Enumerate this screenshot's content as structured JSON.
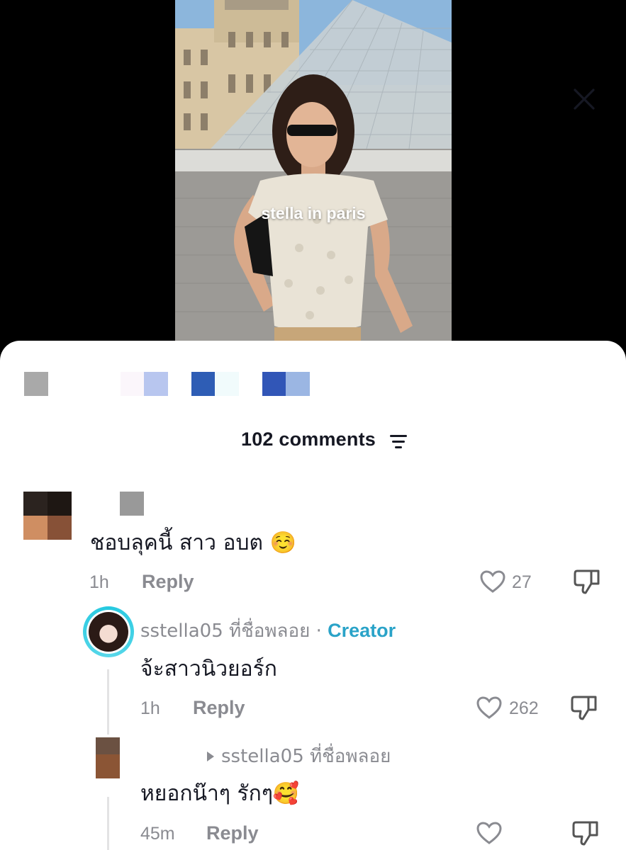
{
  "video": {
    "caption": "stella in paris"
  },
  "header": {
    "comment_count": "102 comments",
    "sort_icon": "sort-lines-icon",
    "close_icon": "close-icon"
  },
  "comments": [
    {
      "text": "ชอบลุคนี้ สาว อบต ☺️",
      "time": "1h",
      "reply_label": "Reply",
      "likes": "27"
    },
    {
      "username": "sstella05 ที่ชื่อพลอย",
      "separator": "·",
      "badge": "Creator",
      "text": "จ้ะสาวนิวยอร์ก",
      "time": "1h",
      "reply_label": "Reply",
      "likes": "262"
    },
    {
      "reply_to": "sstella05 ที่ชื่อพลอย",
      "text": "หยอกน๊าๆ รักๆ🥰",
      "time": "45m",
      "reply_label": "Reply",
      "likes": ""
    }
  ],
  "colors": {
    "text_primary": "#161823",
    "text_secondary": "#8a8b91",
    "creator_accent": "#2aa3c8"
  }
}
